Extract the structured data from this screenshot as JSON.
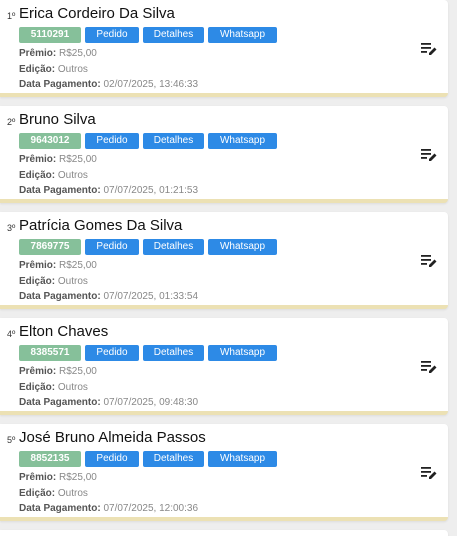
{
  "labels": {
    "premio": "Prêmio:",
    "edicao": "Edição:",
    "data_pagamento": "Data Pagamento:",
    "pedido_button": "Pedido",
    "detalhes_button": "Detalhes",
    "whatsapp_button": "Whatsapp"
  },
  "icons": {
    "action": "playlist-edit-icon"
  },
  "colors": {
    "code_badge": "#86c09a",
    "button": "#2d8ae6",
    "card_underline": "#ece1b4"
  },
  "winners": [
    {
      "rank": "1º",
      "name": "Erica Cordeiro Da Silva",
      "code": "5110291",
      "premio": "R$25,00",
      "edicao": "Outros",
      "data_pagamento": "02/07/2025, 13:46:33"
    },
    {
      "rank": "2º",
      "name": "Bruno Silva",
      "code": "9643012",
      "premio": "R$25,00",
      "edicao": "Outros",
      "data_pagamento": "07/07/2025, 01:21:53"
    },
    {
      "rank": "3º",
      "name": "Patrícia Gomes Da Silva",
      "code": "7869775",
      "premio": "R$25,00",
      "edicao": "Outros",
      "data_pagamento": "07/07/2025, 01:33:54"
    },
    {
      "rank": "4º",
      "name": "Elton Chaves",
      "code": "8385571",
      "premio": "R$25,00",
      "edicao": "Outros",
      "data_pagamento": "07/07/2025, 09:48:30"
    },
    {
      "rank": "5º",
      "name": "José Bruno Almeida Passos",
      "code": "8852135",
      "premio": "R$25,00",
      "edicao": "Outros",
      "data_pagamento": "07/07/2025, 12:00:36"
    }
  ]
}
